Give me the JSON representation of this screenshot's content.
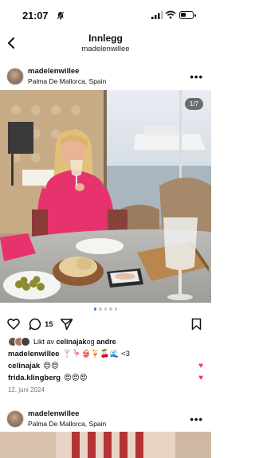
{
  "status_bar": {
    "time": "21:07"
  },
  "nav": {
    "title": "Innlegg",
    "subtitle": "madelenwillee"
  },
  "post": {
    "username": "madelenwillee",
    "location": "Palma De Mallorca, Spain",
    "image_counter": "1/7",
    "carousel_dots": 5,
    "carousel_active": 0,
    "comment_count": "15",
    "liked_by": {
      "prefix": "Likt av ",
      "user1": "celinajak",
      "middle": " og ",
      "user2": "andre"
    },
    "caption": {
      "user": "madelenwillee",
      "text": "🍸🦩👙🍹🍒🌊 <3"
    },
    "comments": [
      {
        "user": "celinajak",
        "text": "😍😍",
        "liked": true
      },
      {
        "user": "frida.klingberg",
        "text": "😍😍😍",
        "liked": true
      }
    ],
    "date": "12. juni 2024"
  },
  "next_post": {
    "username": "madelenwillee",
    "location": "Palma De Mallorca, Spain"
  },
  "colors": {
    "accent_blue": "#3b82f6",
    "like_red": "#ef3a55",
    "dress_pink": "#e8326e"
  }
}
